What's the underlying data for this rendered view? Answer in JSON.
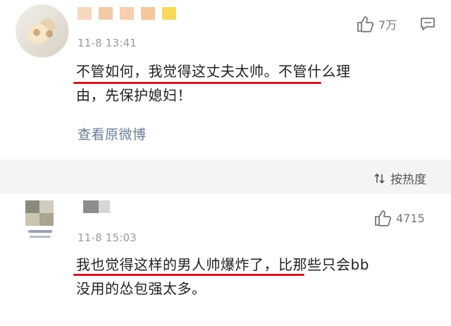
{
  "comments": [
    {
      "timestamp": "11-8 13:41",
      "likes": "7万",
      "text_line1": "不管如何，我觉得这丈夫太帅。不管什么理",
      "text_line2": "由，先保护媳妇！",
      "view_original": "查看原微博"
    },
    {
      "timestamp": "11-8 15:03",
      "likes": "4715",
      "text_line1": "我也觉得这样的男人帅爆炸了，比那些只会bb",
      "text_line2": "没用的怂包强太多。"
    }
  ],
  "sort_label": "按热度",
  "colors": {
    "underline": "#c61a22",
    "link": "#6b7c96",
    "meta": "#9a9a9a"
  },
  "icons": [
    "thumb-up-icon",
    "comment-icon",
    "sort-icon"
  ]
}
